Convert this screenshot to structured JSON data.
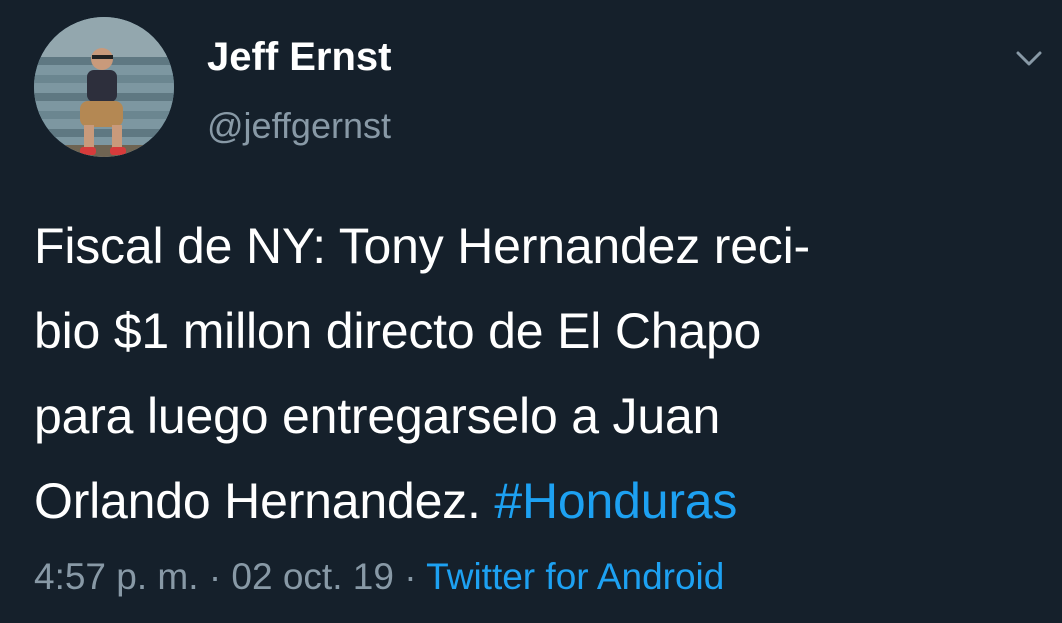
{
  "user": {
    "display_name": "Jeff Ernst",
    "handle": "@jeffgernst",
    "avatar_icon": "user-avatar-photo"
  },
  "menu": {
    "icon": "chevron-down-icon"
  },
  "tweet": {
    "lines": [
      "Fiscal de NY: Tony Hernandez reci-",
      "bio $1 millon directo de El Chapo",
      "para luego entregarselo a Juan",
      "Orlando Hernandez."
    ],
    "hashtag": "#Honduras"
  },
  "meta": {
    "time": "4:57 p. m.",
    "separator": "·",
    "date": "02 oct. 19",
    "source": "Twitter for Android"
  },
  "colors": {
    "background": "#15202b",
    "primary_text": "#ffffff",
    "secondary_text": "#8899a6",
    "accent": "#1da1f2"
  }
}
